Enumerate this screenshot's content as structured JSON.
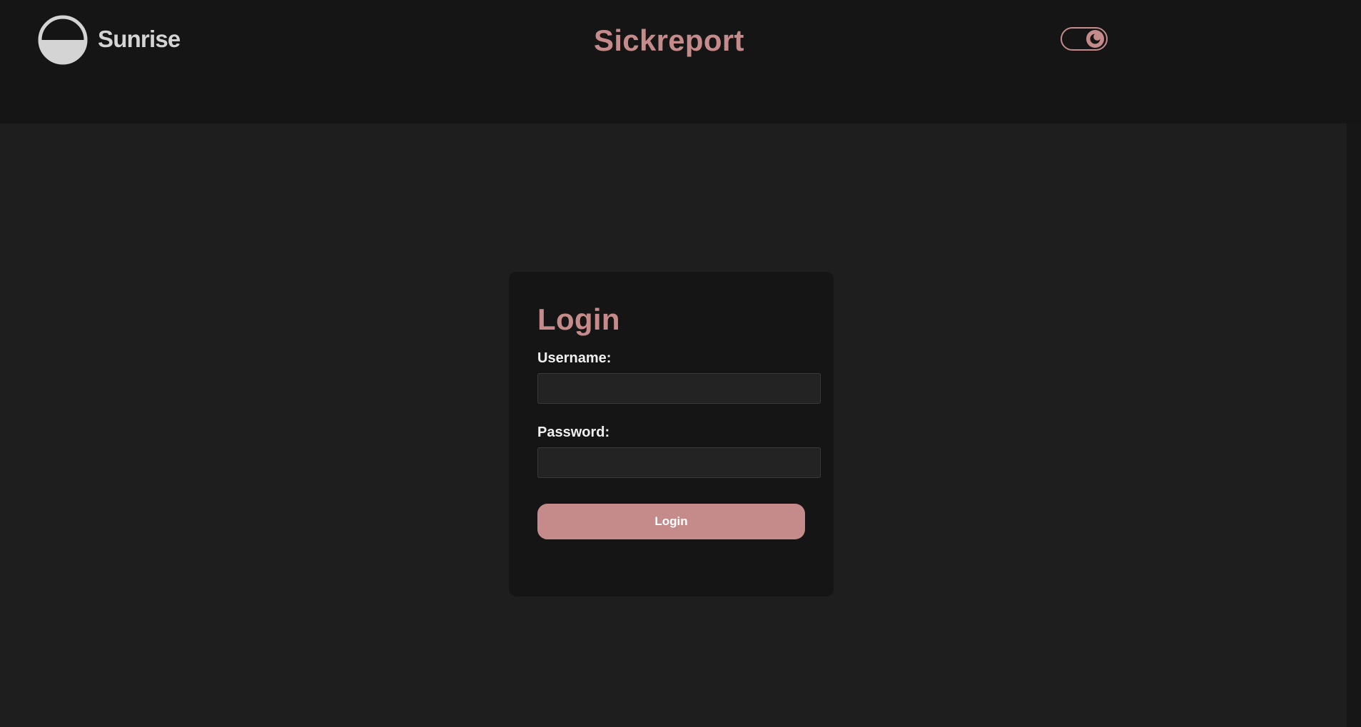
{
  "header": {
    "logo_text": "Sunrise",
    "logo_icon": "sunrise-half-circle-logo",
    "title": "Sickreport",
    "theme_toggle": {
      "icon": "moon-icon",
      "mode": "dark"
    }
  },
  "login": {
    "heading": "Login",
    "username_label": "Username:",
    "username_value": "",
    "password_label": "Password:",
    "password_value": "",
    "submit_label": "Login"
  },
  "colors": {
    "accent": "#c48b8a",
    "header_background": "#151515",
    "page_background": "#1e1e1e",
    "card_background": "#151515",
    "input_background": "#232323",
    "label_text": "#f0f0f0",
    "logo_text": "#d4d4d4"
  }
}
